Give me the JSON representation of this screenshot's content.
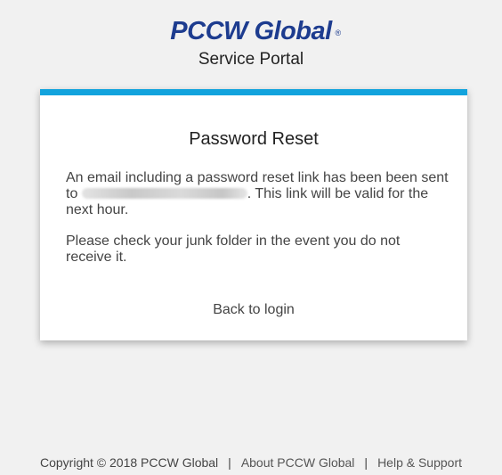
{
  "header": {
    "logo_text": "PCCW Global",
    "logo_mark": "®",
    "portal_title": "Service Portal"
  },
  "colors": {
    "logo": "#1d3c8f",
    "accent_bar": "#12a3dd",
    "background": "#f1f1f1"
  },
  "card": {
    "title": "Password Reset",
    "message_prefix": "An email including a password reset link has been been sent to ",
    "message_suffix": ". This link will be valid for the next hour.",
    "junk_notice": "Please check your junk folder in the event you do not receive it.",
    "back_link": "Back to login"
  },
  "footer": {
    "copyright": "Copyright © 2018 PCCW Global",
    "separator": "|",
    "about_link": "About PCCW Global",
    "help_link": "Help & Support"
  }
}
